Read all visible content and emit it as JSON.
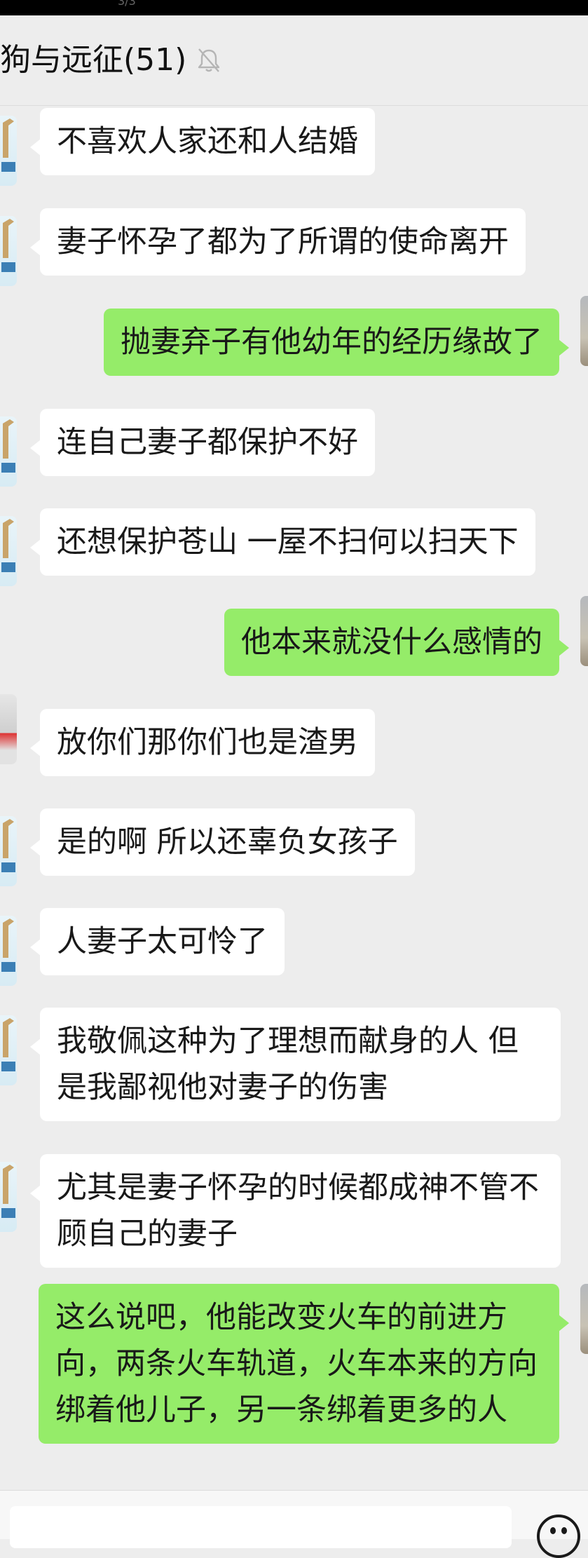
{
  "status_bar": {
    "page_indicator": "3/3"
  },
  "chat": {
    "title": "狗与远征(51)",
    "muted": true
  },
  "messages": [
    {
      "side": "in",
      "avatar": "giraffe",
      "text": "不喜欢人家还和人结婚"
    },
    {
      "side": "in",
      "avatar": "giraffe",
      "text": "妻子怀孕了都为了所谓的使命离开"
    },
    {
      "side": "out",
      "avatar": "mine",
      "text": "抛妻弃子有他幼年的经历缘故了"
    },
    {
      "side": "in",
      "avatar": "giraffe",
      "text": "连自己妻子都保护不好"
    },
    {
      "side": "in",
      "avatar": "giraffe",
      "text": "还想保护苍山  一屋不扫何以扫天下"
    },
    {
      "side": "out",
      "avatar": "mine",
      "text": "他本来就没什么感情的"
    },
    {
      "side": "in",
      "avatar": "photo",
      "text": "放你们那你们也是渣男"
    },
    {
      "side": "in",
      "avatar": "giraffe",
      "text": "是的啊 所以还辜负女孩子"
    },
    {
      "side": "in",
      "avatar": "giraffe",
      "text": "人妻子太可怜了"
    },
    {
      "side": "in",
      "avatar": "giraffe",
      "text": "我敬佩这种为了理想而献身的人 但是我鄙视他对妻子的伤害"
    },
    {
      "side": "in",
      "avatar": "giraffe",
      "text": "尤其是妻子怀孕的时候都成神不管不顾自己的妻子"
    },
    {
      "side": "out",
      "avatar": "mine",
      "text": "这么说吧，他能改变火车的前进方向，两条火车轨道，火车本来的方向绑着他儿子，另一条绑着更多的人"
    }
  ],
  "input": {
    "placeholder": ""
  },
  "icons": {
    "mute": "bell-off-icon",
    "emoji": "emoji-icon"
  },
  "colors": {
    "background": "#ededed",
    "incoming_bubble": "#ffffff",
    "outgoing_bubble": "#95ec69"
  }
}
